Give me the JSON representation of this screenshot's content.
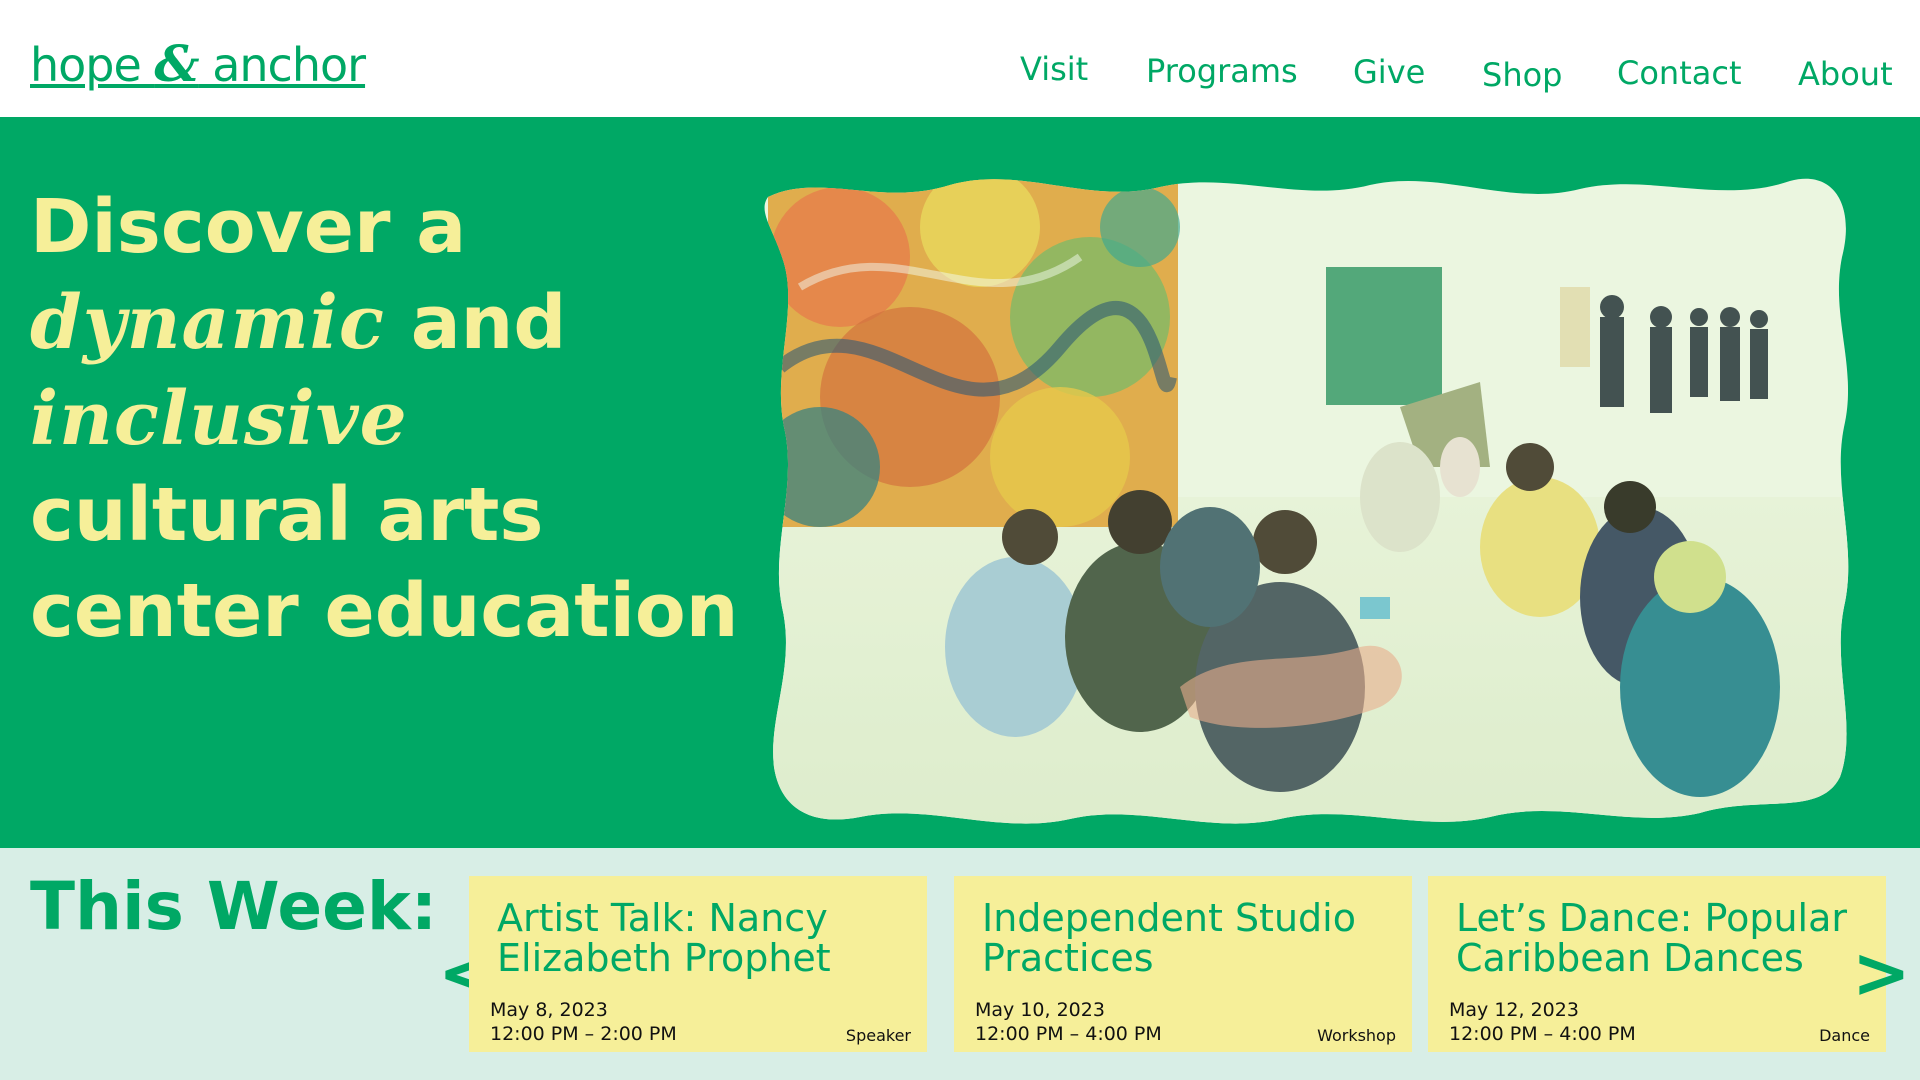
{
  "brand": {
    "name_part1": "hope ",
    "name_amp": "&",
    "name_part2": " anchor",
    "color": "#00a865",
    "accent": "#f6ef99",
    "light_bg": "#d8eee6"
  },
  "nav": {
    "items": [
      {
        "label": "Visit"
      },
      {
        "label": "Programs"
      },
      {
        "label": "Give"
      },
      {
        "label": "Shop"
      },
      {
        "label": "Contact"
      },
      {
        "label": "About"
      }
    ]
  },
  "hero": {
    "line1": "Discover a",
    "line2_fancy": "dynamic",
    "line2_rest": " and",
    "line3_fancy": "inclusive",
    "line4": "cultural arts",
    "line5": "center education"
  },
  "week": {
    "title": "This Week:",
    "prev_icon": "chevron-left-icon",
    "next_icon": "chevron-right-icon",
    "prev_glyph": "<",
    "next_glyph": ">",
    "events": [
      {
        "title": "Artist Talk: Nancy Elizabeth Prophet",
        "date": "May 8, 2023",
        "time": "12:00 PM – 2:00 PM",
        "category": "Speaker"
      },
      {
        "title": "Independent Studio Practices",
        "date": "May 10, 2023",
        "time": "12:00 PM – 4:00 PM",
        "category": "Workshop"
      },
      {
        "title": "Let’s Dance: Popular Caribbean Dances",
        "date": "May 12, 2023",
        "time": "12:00 PM – 4:00 PM",
        "category": "Dance"
      }
    ]
  }
}
